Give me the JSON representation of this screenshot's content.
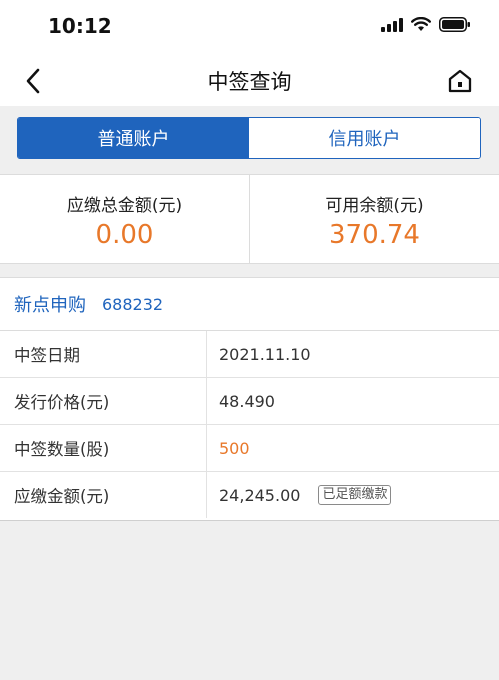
{
  "status_bar": {
    "time": "10:12",
    "icons": [
      "signal-icon",
      "wifi-icon",
      "battery-icon"
    ]
  },
  "nav": {
    "title": "中签查询",
    "back_icon": "chevron-left-icon",
    "home_icon": "home-icon"
  },
  "tabs": [
    {
      "label": "普通账户",
      "active": true
    },
    {
      "label": "信用账户",
      "active": false
    }
  ],
  "summary": {
    "total_due_label": "应缴总金额(元)",
    "total_due_value": "0.00",
    "available_label": "可用余额(元)",
    "available_value": "370.74"
  },
  "detail": {
    "name": "新点申购",
    "code": "688232",
    "rows": [
      {
        "label": "中签日期",
        "value": "2021.11.10"
      },
      {
        "label": "发行价格(元)",
        "value": "48.490"
      },
      {
        "label": "中签数量(股)",
        "value": "500"
      },
      {
        "label": "应缴金额(元)",
        "value": "24,245.00",
        "badge": "已足额缴款"
      }
    ]
  },
  "colors": {
    "accent": "#1f64bd",
    "highlight": "#e8782a",
    "background": "#efefef"
  }
}
